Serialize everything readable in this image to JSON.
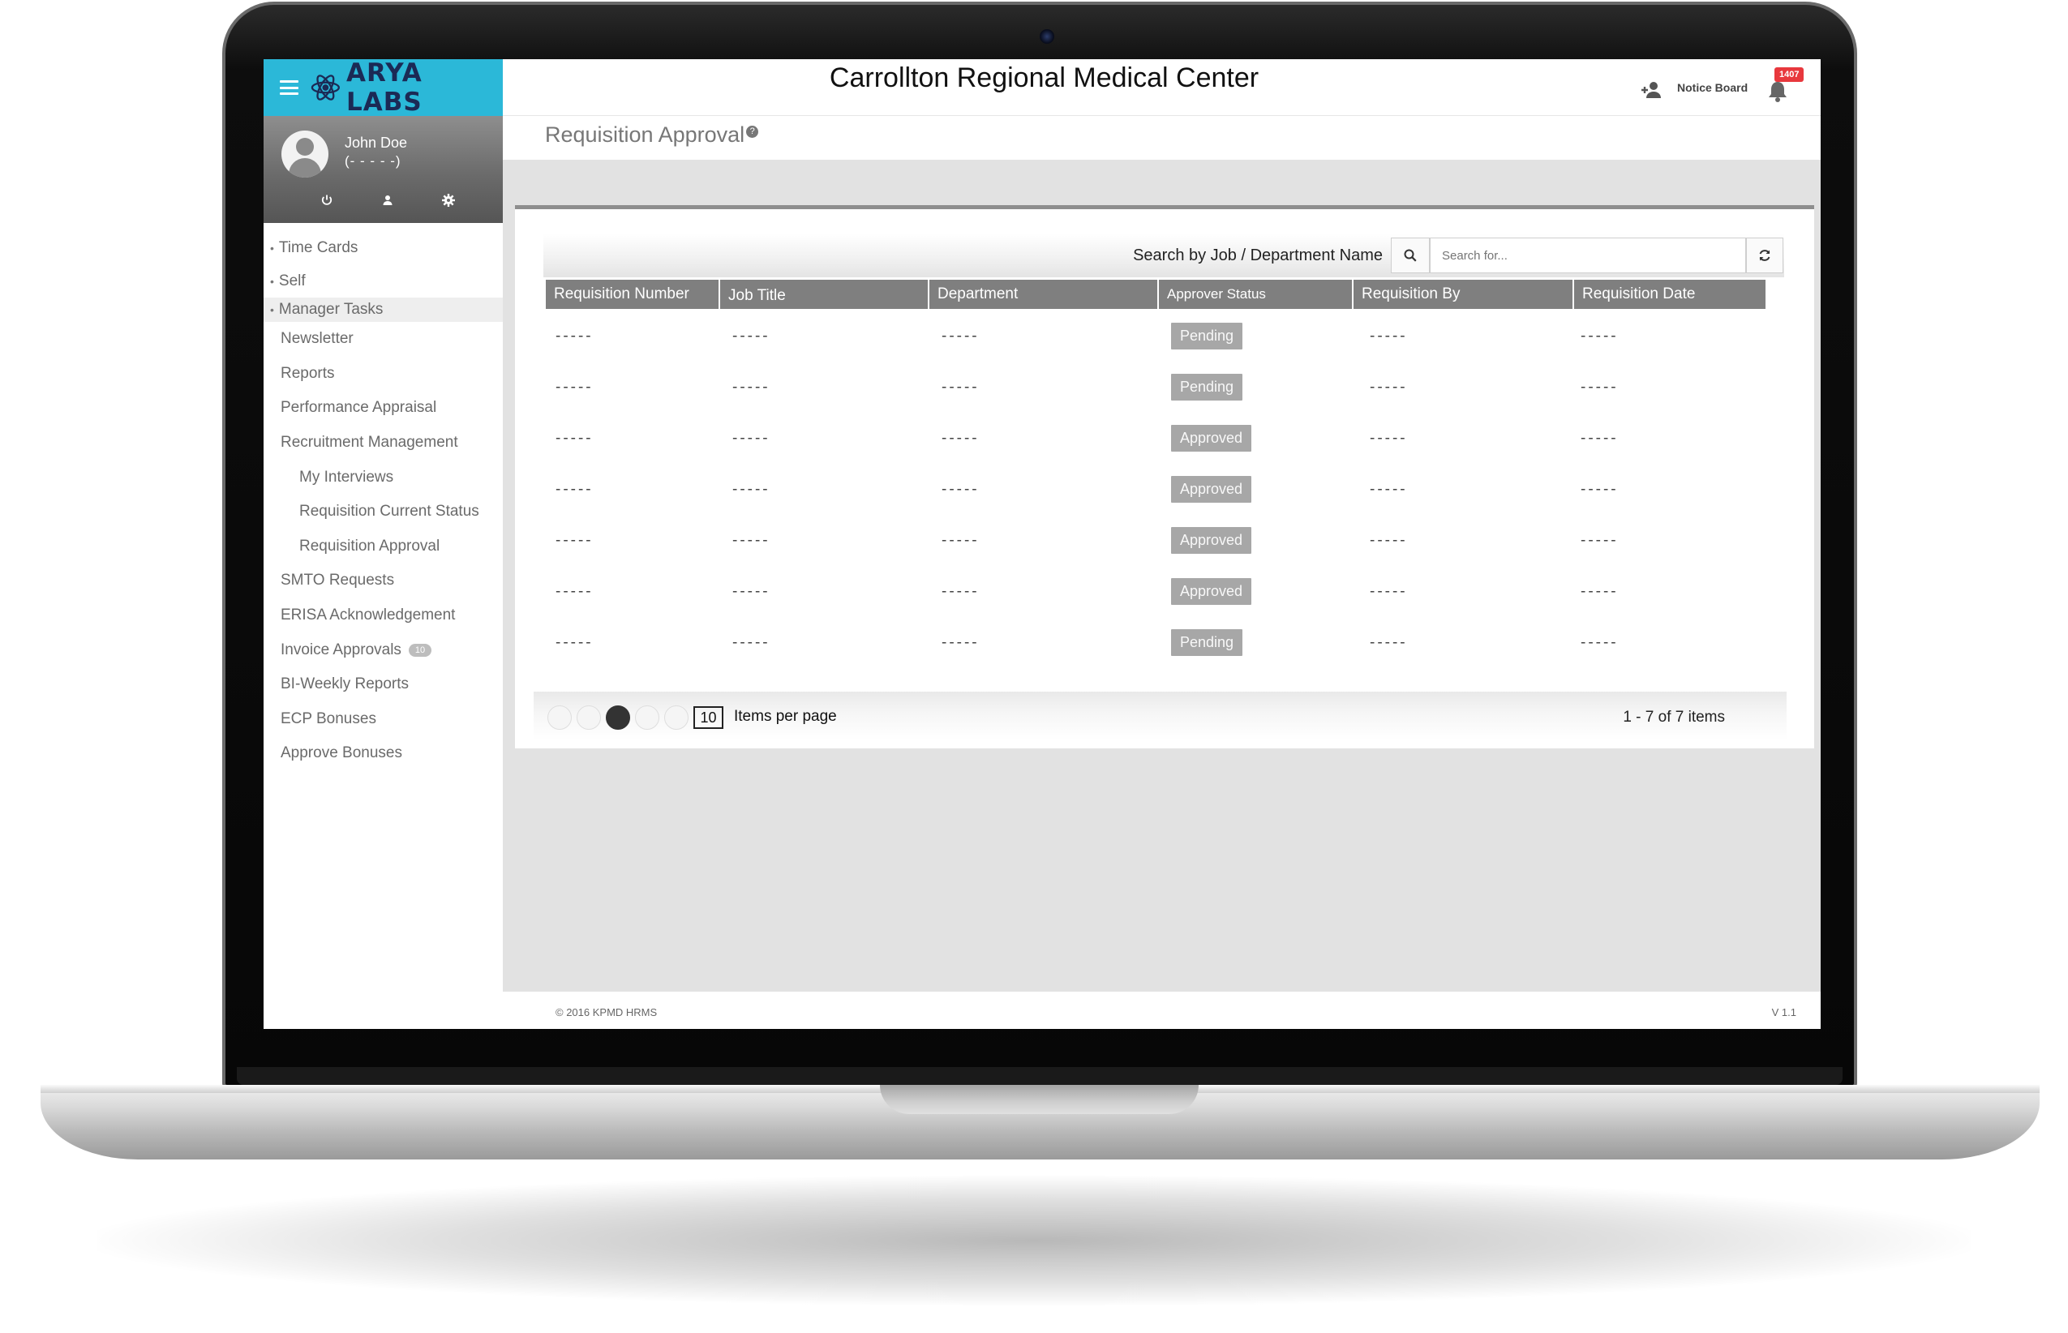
{
  "sidebar": {
    "brand": "ARYA LABS",
    "user_name": "John Doe",
    "user_role": "(- - - - -)",
    "items": [
      {
        "label": "Time Cards"
      },
      {
        "label": "Self"
      },
      {
        "label": "Manager Tasks"
      },
      {
        "label": "Newsletter"
      },
      {
        "label": "Reports"
      },
      {
        "label": "Performance Appraisal"
      },
      {
        "label": "Recruitment Management"
      },
      {
        "label": "My Interviews"
      },
      {
        "label": "Requisition Current Status"
      },
      {
        "label": "Requisition Approval"
      },
      {
        "label": "SMTO Requests"
      },
      {
        "label": "ERISA Acknowledgement"
      },
      {
        "label": "Invoice Approvals",
        "badge": "10"
      },
      {
        "label": "BI-Weekly Reports"
      },
      {
        "label": "ECP Bonuses"
      },
      {
        "label": "Approve Bonuses"
      }
    ]
  },
  "header": {
    "title": "Carrollton Regional Medical Center",
    "notice_board": "Notice Board",
    "notification_count": "1407"
  },
  "page": {
    "title": "Requisition Approval",
    "help": "?"
  },
  "search": {
    "label": "Search by Job / Department Name",
    "placeholder": "Search for..."
  },
  "table": {
    "columns": [
      "Requisition Number",
      "Job Title",
      "Department",
      "Approver Status",
      "Requisition By",
      "Requisition Date"
    ],
    "rows": [
      {
        "number": "-----",
        "job": "-----",
        "dept": "-----",
        "status": "Pending",
        "by": "-----",
        "date": "-----"
      },
      {
        "number": "-----",
        "job": "-----",
        "dept": "-----",
        "status": "Pending",
        "by": "-----",
        "date": "-----"
      },
      {
        "number": "-----",
        "job": "-----",
        "dept": "-----",
        "status": "Approved",
        "by": "-----",
        "date": "-----"
      },
      {
        "number": "-----",
        "job": "-----",
        "dept": "-----",
        "status": "Approved",
        "by": "-----",
        "date": "-----"
      },
      {
        "number": "-----",
        "job": "-----",
        "dept": "-----",
        "status": "Approved",
        "by": "-----",
        "date": "-----"
      },
      {
        "number": "-----",
        "job": "-----",
        "dept": "-----",
        "status": "Approved",
        "by": "-----",
        "date": "-----"
      },
      {
        "number": "-----",
        "job": "-----",
        "dept": "-----",
        "status": "Pending",
        "by": "-----",
        "date": "-----"
      }
    ]
  },
  "pager": {
    "page_size": "10",
    "per_page_label": "Items per page",
    "range": "1 - 7 of 7 items"
  },
  "footer": {
    "copyright": "©   2016 KPMD HRMS",
    "version": "V 1.1"
  },
  "colors": {
    "brand_bar": "#2bb8d8",
    "table_header": "#7f7f7f",
    "status_badge": "#a7a7a7",
    "notification": "#e8383d"
  }
}
